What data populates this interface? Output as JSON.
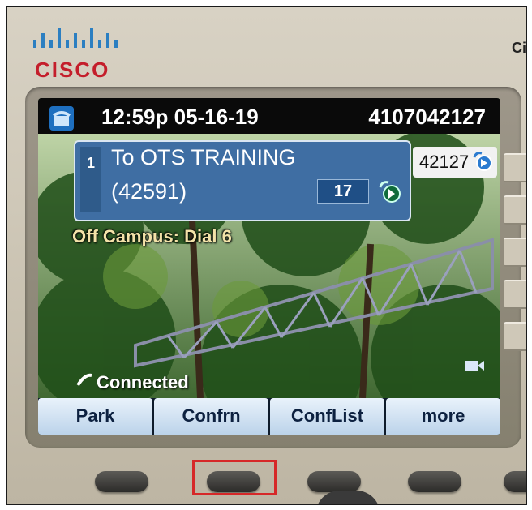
{
  "brand": {
    "name": "CISCO",
    "right_partial": "Ci"
  },
  "status": {
    "time_date": "12:59p 05-16-19",
    "phone_number": "4107042127"
  },
  "call": {
    "line": "1",
    "name": "To OTS TRAINING",
    "number": "(42591)",
    "duration": "17"
  },
  "line_button": {
    "extension": "42127"
  },
  "banner": "Off Campus: Dial 6",
  "call_state": "Connected",
  "softkeys": [
    "Park",
    "Confrn",
    "ConfList",
    "more"
  ],
  "colors": {
    "cisco_red": "#c41e2b",
    "call_blue": "#3f6ea3",
    "highlight": "#d62828"
  }
}
